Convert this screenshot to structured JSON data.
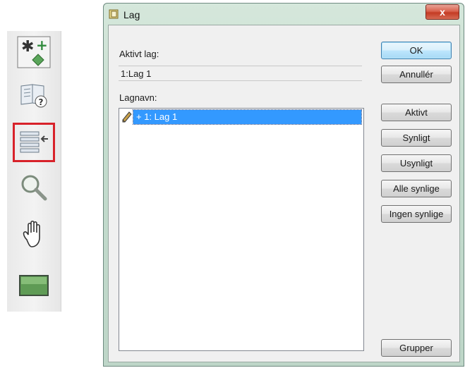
{
  "toolbar": {
    "items": [
      {
        "name": "add-shape-icon",
        "selected": false
      },
      {
        "name": "help-book-icon",
        "selected": false
      },
      {
        "name": "layers-icon",
        "selected": true
      },
      {
        "name": "zoom-icon",
        "selected": false
      },
      {
        "name": "pan-hand-icon",
        "selected": false
      },
      {
        "name": "map-view-icon",
        "selected": false
      }
    ],
    "highlight_color": "#d8222a"
  },
  "dialog": {
    "title": "Lag",
    "close_label": "x",
    "active_layer_label": "Aktivt lag:",
    "active_layer_value": "1:Lag 1",
    "layer_names_label": "Lagnavn:",
    "layers": [
      {
        "text": "+ 1: Lag 1",
        "selected": true,
        "icon": "pencil-icon"
      }
    ],
    "buttons": {
      "ok": "OK",
      "cancel": "Annullér",
      "active": "Aktivt",
      "visible": "Synligt",
      "invisible": "Usynligt",
      "all_visible": "Alle synlige",
      "none_visible": "Ingen synlige",
      "groups": "Grupper"
    },
    "selection_color": "#3399ff"
  }
}
